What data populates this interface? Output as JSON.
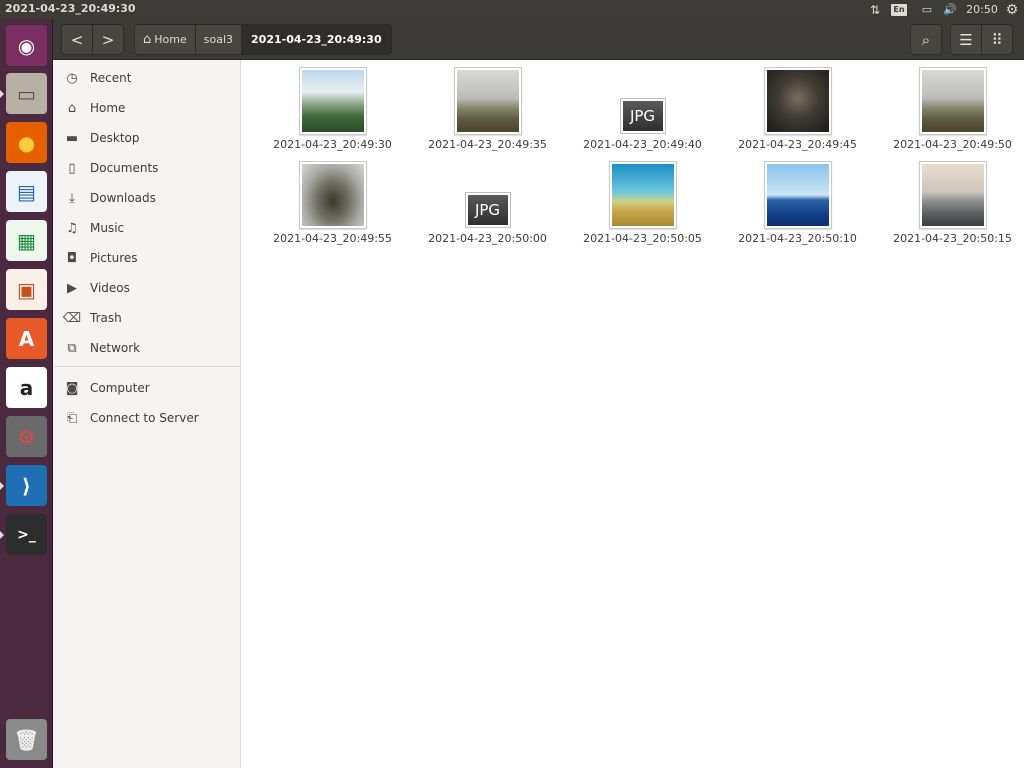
{
  "window_title": "2021-04-23_20:49:30",
  "tray": {
    "network": "⇅",
    "lang": "En",
    "battery": "▭",
    "sound": "🔊",
    "clock": "20:50",
    "settings": "⚙"
  },
  "launcher": [
    {
      "name": "ubuntu-dash-icon",
      "glyph": "◉",
      "bg": "#7a2f63",
      "fg": "#f4f4f4"
    },
    {
      "name": "files-icon",
      "glyph": "▭",
      "bg": "#b8b0a4",
      "fg": "#5b4f45",
      "running": true
    },
    {
      "name": "firefox-icon",
      "glyph": "●",
      "bg": "#e66000",
      "fg": "#ffcb3d"
    },
    {
      "name": "writer-icon",
      "glyph": "▤",
      "bg": "#eef3f9",
      "fg": "#2a67b3"
    },
    {
      "name": "calc-icon",
      "glyph": "▦",
      "bg": "#eef6ee",
      "fg": "#1f8c3b"
    },
    {
      "name": "impress-icon",
      "glyph": "▣",
      "bg": "#fbf0e8",
      "fg": "#c9501c"
    },
    {
      "name": "software-center-icon",
      "glyph": "A",
      "bg": "#e8592a",
      "fg": "#ffffff"
    },
    {
      "name": "amazon-icon",
      "glyph": "a",
      "bg": "#ffffff",
      "fg": "#222222"
    },
    {
      "name": "system-settings-icon",
      "glyph": "⚙",
      "bg": "#6a6a6a",
      "fg": "#e14545"
    },
    {
      "name": "vscode-icon",
      "glyph": "⟩",
      "bg": "#1f6fb5",
      "fg": "#ffffff",
      "running": true
    },
    {
      "name": "terminal-icon",
      "glyph": ">_",
      "bg": "#2d2d2d",
      "fg": "#ffffff",
      "running": true
    },
    {
      "name": "trash-launcher-icon",
      "glyph": "🗑",
      "bg": "#8a8a8a",
      "fg": "#eeeeee"
    }
  ],
  "toolbar": {
    "back": "<",
    "forward": ">",
    "search": "⌕",
    "list_view": "☰",
    "grid_view": "⠿"
  },
  "pathbar": {
    "home_glyph": "⌂",
    "home": "Home",
    "folder": "soal3",
    "current": "2021-04-23_20:49:30"
  },
  "sidebar": {
    "items": [
      {
        "label": "Recent",
        "glyph": "◷"
      },
      {
        "label": "Home",
        "glyph": "⌂"
      },
      {
        "label": "Desktop",
        "glyph": "▬"
      },
      {
        "label": "Documents",
        "glyph": "▯"
      },
      {
        "label": "Downloads",
        "glyph": "⤓"
      },
      {
        "label": "Music",
        "glyph": "♫"
      },
      {
        "label": "Pictures",
        "glyph": "◘"
      },
      {
        "label": "Videos",
        "glyph": "▶"
      },
      {
        "label": "Trash",
        "glyph": "⌫"
      },
      {
        "label": "Network",
        "glyph": "⧉"
      }
    ],
    "devices": [
      {
        "label": "Computer",
        "glyph": "◙"
      },
      {
        "label": "Connect to Server",
        "glyph": "⎗"
      }
    ]
  },
  "files": [
    {
      "name": "2021-04-23_20:49:30",
      "kind": "thumb",
      "gradient": "linear-gradient(#bcd7ea 0%, #e8eef2 35%, #8fa58a 55%, #3f6b3a 75%, #294b2a 100%)"
    },
    {
      "name": "2021-04-23_20:49:35",
      "kind": "thumb",
      "gradient": "linear-gradient(#d9d9d6 0%, #bdbdb8 45%, #8a8a74 60%, #5b5a3a 80%, #4a4530 100%)"
    },
    {
      "name": "2021-04-23_20:49:40",
      "kind": "jpg",
      "label": "JPG"
    },
    {
      "name": "2021-04-23_20:49:45",
      "kind": "thumb",
      "gradient": "radial-gradient(circle at 50% 45%, #7b6d5b 0%, #3f3a33 45%, #1d1b18 100%)"
    },
    {
      "name": "2021-04-23_20:49:50",
      "kind": "thumb",
      "gradient": "linear-gradient(#d9d9d6 0%, #bdbdb8 45%, #8a8a74 60%, #5b5a3a 80%, #4a4530 100%)"
    },
    {
      "name": "2021-04-23_20:49:55",
      "kind": "thumb",
      "gradient": "radial-gradient(ellipse at 50% 60%, #3a3a2a 0%, #6d6d62 35%, #a9aaa4 65%, #d5d6d2 100%)"
    },
    {
      "name": "2021-04-23_20:50:00",
      "kind": "jpg",
      "label": "JPG"
    },
    {
      "name": "2021-04-23_20:50:05",
      "kind": "thumb",
      "gradient": "linear-gradient(#1d8fc4 0%, #6cc7de 45%, #cfcf8a 60%, #c9a94a 75%, #a78a35 100%)"
    },
    {
      "name": "2021-04-23_20:50:10",
      "kind": "thumb",
      "gradient": "linear-gradient(#8cc3ec 0%, #cbe4f5 50%, #2d63a6 58%, #13408a 80%, #0c2f6b 100%)"
    },
    {
      "name": "2021-04-23_20:50:15",
      "kind": "thumb",
      "gradient": "linear-gradient(#e9dccd 0%, #cdc6bb 45%, #8d8f8d 60%, #5c6061 80%, #3c3f40 100%)"
    }
  ]
}
